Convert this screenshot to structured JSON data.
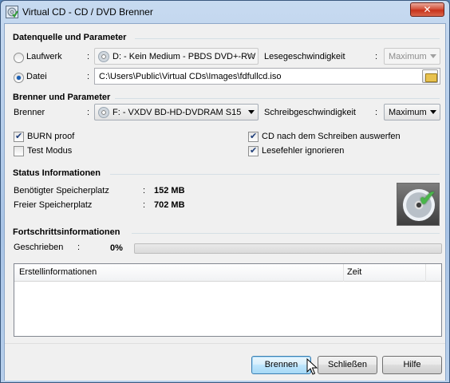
{
  "window": {
    "title": "Virtual CD - CD / DVD Brenner",
    "close_label": "✕"
  },
  "source": {
    "group_title": "Datenquelle und Parameter",
    "drive_label": "Laufwerk",
    "drive_selected": false,
    "drive_value": "D: - Kein Medium - PBDS DVD+-RW",
    "read_speed_label": "Lesegeschwindigkeit",
    "read_speed_value": "Maximum",
    "file_label": "Datei",
    "file_selected": true,
    "file_path": "C:\\Users\\Public\\Virtual CDs\\Images\\fdfullcd.iso"
  },
  "burner": {
    "group_title": "Brenner und Parameter",
    "burner_label": "Brenner",
    "burner_value": "F: - VXDV BD-HD-DVDRAM S15",
    "write_speed_label": "Schreibgeschwindigkeit",
    "write_speed_value": "Maximum",
    "options": [
      {
        "label": "BURN proof",
        "checked": true
      },
      {
        "label": "Test Modus",
        "checked": false
      },
      {
        "label": "CD nach dem Schreiben auswerfen",
        "checked": true
      },
      {
        "label": "Lesefehler ignorieren",
        "checked": true
      }
    ]
  },
  "status": {
    "group_title": "Status Informationen",
    "required_label": "Benötigter Speicherplatz",
    "required_value": "152 MB",
    "free_label": "Freier Speicherplatz",
    "free_value": "702 MB"
  },
  "progress": {
    "group_title": "Fortschrittsinformationen",
    "written_label": "Geschrieben",
    "written_value": "0%",
    "fraction": 0
  },
  "log": {
    "columns": [
      "Erstellinformationen",
      "Zeit"
    ],
    "rows": []
  },
  "buttons": {
    "burn": "Brennen",
    "close": "Schließen",
    "help": "Hilfe"
  },
  "colon": ":"
}
